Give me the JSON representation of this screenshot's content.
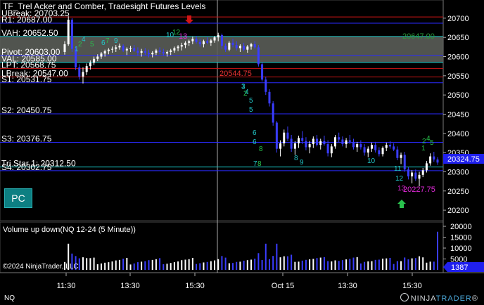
{
  "window": {
    "title": "TF_Trel Acker and Comber, Tradesight Futures Levels",
    "instrument_footer": "NQ",
    "copyright": "©2024 NinjaTrader, LLC",
    "pc_button_label": "PC",
    "logo": {
      "part1": "NINJA",
      "part2": "TRADER",
      "reg": "®"
    }
  },
  "colors": {
    "background": "#000000",
    "candle_up": "#ffffff",
    "candle_down": "#3a3dff",
    "level_red": "#d11515",
    "level_blue": "#2a2aff",
    "level_teal": "#19c6c6",
    "value_area_fill": "#5a5d58",
    "price_tag": "#2020ee",
    "count_cyan": "#22c7c9",
    "count_green": "#29c24d",
    "count_magenta": "#e12ad9"
  },
  "chart_data": {
    "type": "candlestick",
    "price_axis": {
      "min": 20180,
      "max": 20740,
      "ticks": [
        20700,
        20650,
        20600,
        20550,
        20500,
        20450,
        20400,
        20350,
        20300,
        20250,
        20200
      ]
    },
    "time_axis": {
      "labels": [
        "11:30",
        "13:30",
        "15:30",
        "Oct 15",
        "13:30",
        "15:30"
      ]
    },
    "last_price": "20324.75",
    "level_lines": [
      {
        "label": "UBreak: 20703.25",
        "price": 20703.25,
        "color": "red"
      },
      {
        "label": "R1: 20687.00",
        "price": 20687,
        "color": "blue"
      },
      {
        "label": "VAH: 20652.50",
        "price": 20652.5,
        "color": "teal"
      },
      {
        "label": "Pivot: 20603.00",
        "price": 20603,
        "color": "blue"
      },
      {
        "label": "VAL: 20585.00",
        "price": 20585,
        "color": "teal"
      },
      {
        "label": "LPT: 20568.75",
        "price": 20568.75,
        "color": "red"
      },
      {
        "label": "LBreak: 20547.00",
        "price": 20547,
        "color": "red"
      },
      {
        "label": "S1: 20531.75",
        "price": 20531.75,
        "color": "blue"
      },
      {
        "label": "S2: 20450.75",
        "price": 20450.75,
        "color": "blue"
      },
      {
        "label": "S3: 20376.75",
        "price": 20376.75,
        "color": "blue"
      },
      {
        "label": "Tri Star 1: 20312.50",
        "price": 20312.5,
        "color": "teal"
      },
      {
        "label": "S4: 20302.75",
        "price": 20302.75,
        "color": "blue"
      }
    ],
    "value_area": {
      "high": 20652.5,
      "low": 20585
    },
    "annotations": [
      {
        "text": "20544.75",
        "color": "red"
      },
      {
        "text": "20227.75",
        "color": "magenta"
      },
      {
        "text": "20647.00",
        "color": "green"
      }
    ],
    "seq_counts_magenta": [
      "13"
    ],
    "down_arrow_at": "15:20",
    "up_arrow_at": "15:00",
    "candles": [
      [
        20612,
        20640,
        20605,
        20632
      ],
      [
        20632,
        20705,
        20628,
        20696
      ],
      [
        20696,
        20700,
        20612,
        20620
      ],
      [
        20620,
        20628,
        20565,
        20572
      ],
      [
        20572,
        20580,
        20540,
        20548
      ],
      [
        20548,
        20572,
        20530,
        20560
      ],
      [
        20560,
        20582,
        20552,
        20575
      ],
      [
        20575,
        20590,
        20566,
        20584
      ],
      [
        20584,
        20600,
        20578,
        20594
      ],
      [
        20594,
        20606,
        20588,
        20600
      ],
      [
        20600,
        20612,
        20594,
        20608
      ],
      [
        20608,
        20618,
        20600,
        20614
      ],
      [
        20614,
        20622,
        20606,
        20618
      ],
      [
        20618,
        20626,
        20610,
        20620
      ],
      [
        20620,
        20630,
        20612,
        20624
      ],
      [
        20624,
        20634,
        20618,
        20628
      ],
      [
        20628,
        20632,
        20612,
        20616
      ],
      [
        20616,
        20624,
        20604,
        20620
      ],
      [
        20620,
        20628,
        20612,
        20622
      ],
      [
        20622,
        20630,
        20612,
        20615
      ],
      [
        20615,
        20624,
        20602,
        20610
      ],
      [
        20610,
        20620,
        20600,
        20614
      ],
      [
        20614,
        20622,
        20604,
        20610
      ],
      [
        20610,
        20618,
        20598,
        20606
      ],
      [
        20606,
        20614,
        20598,
        20610
      ],
      [
        20610,
        20620,
        20604,
        20616
      ],
      [
        20616,
        20624,
        20606,
        20612
      ],
      [
        20612,
        20620,
        20602,
        20608
      ],
      [
        20608,
        20616,
        20600,
        20612
      ],
      [
        20612,
        20620,
        20604,
        20616
      ],
      [
        20616,
        20626,
        20610,
        20622
      ],
      [
        20622,
        20630,
        20614,
        20626
      ],
      [
        20626,
        20636,
        20616,
        20630
      ],
      [
        20630,
        20640,
        20622,
        20636
      ],
      [
        20636,
        20644,
        20628,
        20640
      ],
      [
        20640,
        20652,
        20632,
        20646
      ],
      [
        20646,
        20654,
        20634,
        20638
      ],
      [
        20638,
        20646,
        20626,
        20632
      ],
      [
        20632,
        20644,
        20624,
        20640
      ],
      [
        20640,
        20650,
        20632,
        20636
      ],
      [
        20636,
        20646,
        20628,
        20642
      ],
      [
        20642,
        20654,
        20636,
        20650
      ],
      [
        20650,
        20662,
        20640,
        20656
      ],
      [
        20656,
        20660,
        20620,
        20628
      ],
      [
        20628,
        20634,
        20612,
        20618
      ],
      [
        20618,
        20640,
        20614,
        20636
      ],
      [
        20636,
        20646,
        20624,
        20630
      ],
      [
        20630,
        20640,
        20616,
        20622
      ],
      [
        20622,
        20632,
        20612,
        20628
      ],
      [
        20628,
        20636,
        20614,
        20618
      ],
      [
        20618,
        20630,
        20610,
        20626
      ],
      [
        20626,
        20636,
        20618,
        20632
      ],
      [
        20632,
        20640,
        20620,
        20624
      ],
      [
        20624,
        20630,
        20574,
        20580
      ],
      [
        20580,
        20585,
        20535,
        20540
      ],
      [
        20540,
        20548,
        20500,
        20508
      ],
      [
        20508,
        20515,
        20470,
        20478
      ],
      [
        20478,
        20484,
        20420,
        20428
      ],
      [
        20428,
        20432,
        20350,
        20360
      ],
      [
        20360,
        20382,
        20340,
        20374
      ],
      [
        20374,
        20410,
        20366,
        20402
      ],
      [
        20402,
        20418,
        20380,
        20386
      ],
      [
        20386,
        20396,
        20352,
        20360
      ],
      [
        20360,
        20380,
        20344,
        20374
      ],
      [
        20374,
        20394,
        20362,
        20388
      ],
      [
        20388,
        20406,
        20372,
        20380
      ],
      [
        20380,
        20390,
        20356,
        20364
      ],
      [
        20364,
        20380,
        20348,
        20372
      ],
      [
        20372,
        20392,
        20362,
        20386
      ],
      [
        20386,
        20396,
        20366,
        20370
      ],
      [
        20370,
        20386,
        20358,
        20380
      ],
      [
        20380,
        20394,
        20368,
        20372
      ],
      [
        20372,
        20382,
        20340,
        20348
      ],
      [
        20348,
        20372,
        20338,
        20366
      ],
      [
        20366,
        20396,
        20360,
        20390
      ],
      [
        20390,
        20402,
        20376,
        20384
      ],
      [
        20384,
        20392,
        20366,
        20372
      ],
      [
        20372,
        20388,
        20362,
        20382
      ],
      [
        20382,
        20396,
        20372,
        20378
      ],
      [
        20378,
        20386,
        20358,
        20364
      ],
      [
        20364,
        20378,
        20352,
        20372
      ],
      [
        20372,
        20382,
        20358,
        20364
      ],
      [
        20364,
        20372,
        20342,
        20350
      ],
      [
        20350,
        20366,
        20338,
        20360
      ],
      [
        20360,
        20376,
        20352,
        20370
      ],
      [
        20370,
        20378,
        20350,
        20356
      ],
      [
        20356,
        20364,
        20340,
        20346
      ],
      [
        20346,
        20366,
        20340,
        20362
      ],
      [
        20362,
        20376,
        20354,
        20370
      ],
      [
        20370,
        20380,
        20360,
        20366
      ],
      [
        20366,
        20374,
        20354,
        20358
      ],
      [
        20358,
        20366,
        20330,
        20336
      ],
      [
        20336,
        20350,
        20320,
        20344
      ],
      [
        20344,
        20352,
        20300,
        20306
      ],
      [
        20306,
        20312,
        20280,
        20288
      ],
      [
        20288,
        20304,
        20270,
        20298
      ],
      [
        20298,
        20306,
        20276,
        20282
      ],
      [
        20282,
        20300,
        20262,
        20292
      ],
      [
        20292,
        20310,
        20286,
        20304
      ],
      [
        20304,
        20328,
        20298,
        20322
      ],
      [
        20322,
        20348,
        20316,
        20340
      ],
      [
        20340,
        20352,
        20326,
        20332
      ],
      [
        20332,
        20338,
        20318,
        20324
      ]
    ],
    "volume_panel": {
      "title": "Volume up down(NQ 12-24 (5 Minute))",
      "axis_ticks": [
        "20000",
        "15000",
        "10000",
        "5000"
      ],
      "last_value": "1387",
      "max": 20000
    }
  }
}
